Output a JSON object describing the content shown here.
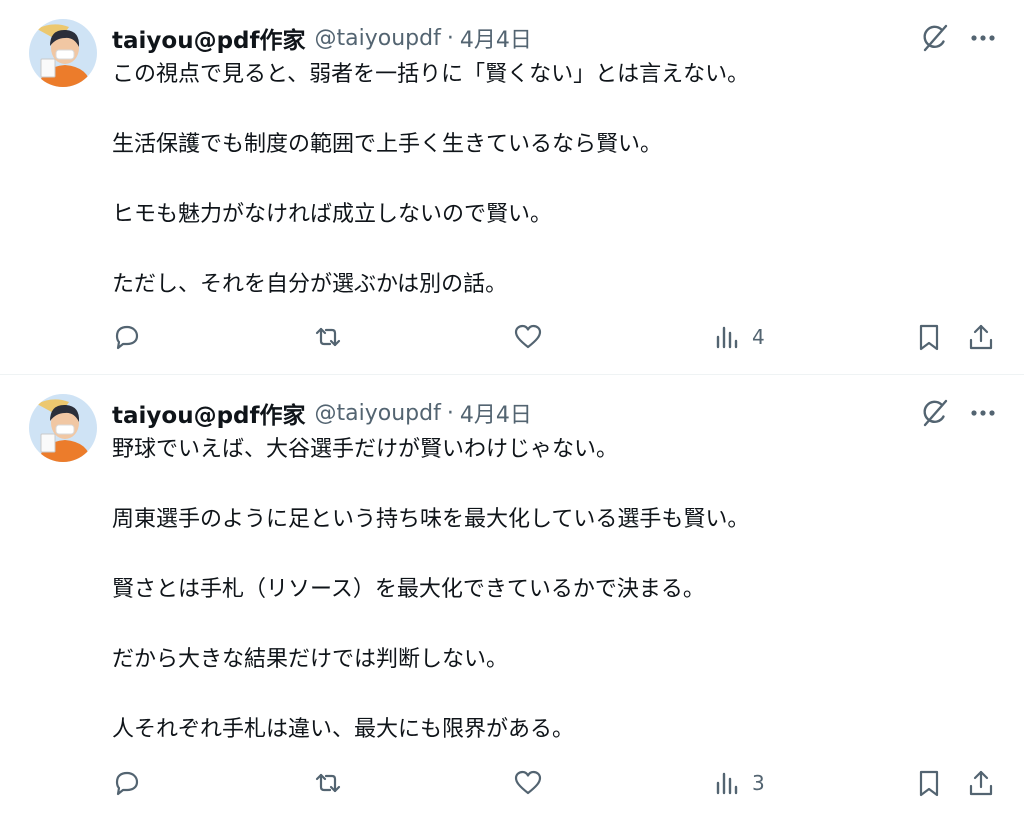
{
  "colors": {
    "text": "#0f1419",
    "muted": "#536471",
    "divider": "#eff3f4"
  },
  "icons": [
    "grok-icon",
    "more-icon",
    "reply-icon",
    "repost-icon",
    "like-icon",
    "views-icon",
    "bookmark-icon",
    "share-icon"
  ],
  "tweets": [
    {
      "author": "taiyou@pdf作家",
      "handle": "@taiyoupdf",
      "separator": "·",
      "date": "4月4日",
      "lines": [
        "この視点で見ると、弱者を一括りに「賢くない」とは言えない。",
        "",
        "生活保護でも制度の範囲で上手く生きているなら賢い。",
        "",
        "ヒモも魅力がなければ成立しないので賢い。",
        "",
        "ただし、それを自分が選ぶかは別の話。"
      ],
      "views": "4"
    },
    {
      "author": "taiyou@pdf作家",
      "handle": "@taiyoupdf",
      "separator": "·",
      "date": "4月4日",
      "lines": [
        "野球でいえば、大谷選手だけが賢いわけじゃない。",
        "",
        "周東選手のように足という持ち味を最大化している選手も賢い。",
        "",
        "賢さとは手札（リソース）を最大化できているかで決まる。",
        "",
        "だから大きな結果だけでは判断しない。",
        "",
        "人それぞれ手札は違い、最大にも限界がある。"
      ],
      "views": "3"
    }
  ]
}
